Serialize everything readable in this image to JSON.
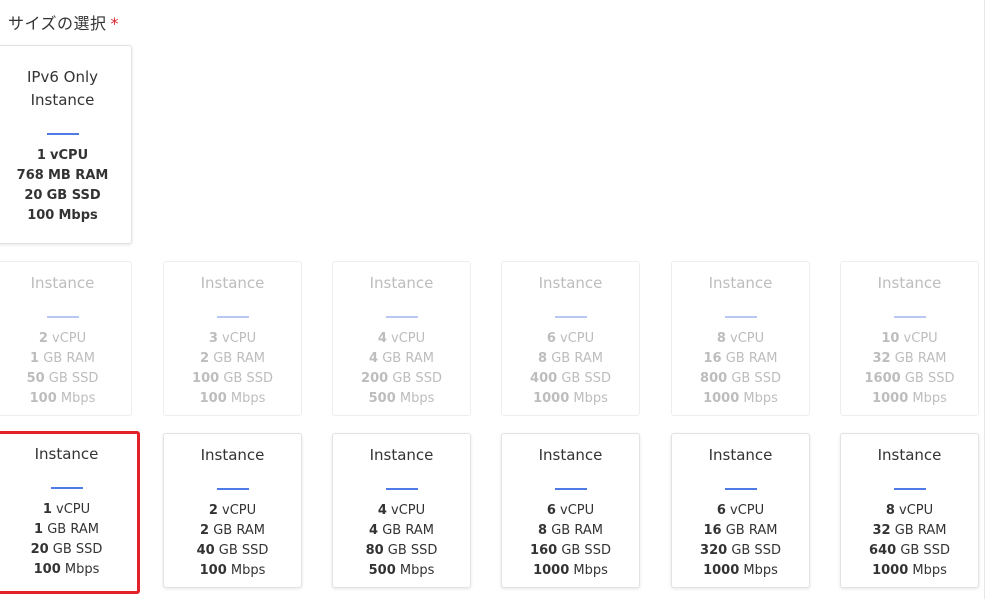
{
  "section": {
    "title": "サイズの選択",
    "required_mark": "*"
  },
  "colors": {
    "accent": "#4f7be8",
    "selected_border": "#e3212b",
    "required": "#e0202a",
    "disabled_text": "#bdbdbd"
  },
  "ipv6_plan": {
    "title_line1": "IPv6 Only",
    "title_line2": "Instance",
    "vcpu_num": "1",
    "vcpu_unit": "vCPU",
    "ram_num": "768",
    "ram_unit": "MB RAM",
    "ssd_num": "20",
    "ssd_unit": "GB SSD",
    "net_num": "100",
    "net_unit": "Mbps"
  },
  "disabled_plans": [
    {
      "title": "Instance",
      "vcpu_num": "2",
      "vcpu_unit": "vCPU",
      "ram_num": "1",
      "ram_unit": "GB RAM",
      "ssd_num": "50",
      "ssd_unit": "GB SSD",
      "net_num": "100",
      "net_unit": "Mbps"
    },
    {
      "title": "Instance",
      "vcpu_num": "3",
      "vcpu_unit": "vCPU",
      "ram_num": "2",
      "ram_unit": "GB RAM",
      "ssd_num": "100",
      "ssd_unit": "GB SSD",
      "net_num": "100",
      "net_unit": "Mbps"
    },
    {
      "title": "Instance",
      "vcpu_num": "4",
      "vcpu_unit": "vCPU",
      "ram_num": "4",
      "ram_unit": "GB RAM",
      "ssd_num": "200",
      "ssd_unit": "GB SSD",
      "net_num": "500",
      "net_unit": "Mbps"
    },
    {
      "title": "Instance",
      "vcpu_num": "6",
      "vcpu_unit": "vCPU",
      "ram_num": "8",
      "ram_unit": "GB RAM",
      "ssd_num": "400",
      "ssd_unit": "GB SSD",
      "net_num": "1000",
      "net_unit": "Mbps"
    },
    {
      "title": "Instance",
      "vcpu_num": "8",
      "vcpu_unit": "vCPU",
      "ram_num": "16",
      "ram_unit": "GB RAM",
      "ssd_num": "800",
      "ssd_unit": "GB SSD",
      "net_num": "1000",
      "net_unit": "Mbps"
    },
    {
      "title": "Instance",
      "vcpu_num": "10",
      "vcpu_unit": "vCPU",
      "ram_num": "32",
      "ram_unit": "GB RAM",
      "ssd_num": "1600",
      "ssd_unit": "GB SSD",
      "net_num": "1000",
      "net_unit": "Mbps"
    }
  ],
  "plans": [
    {
      "title": "Instance",
      "vcpu_num": "1",
      "vcpu_unit": "vCPU",
      "ram_num": "1",
      "ram_unit": "GB RAM",
      "ssd_num": "20",
      "ssd_unit": "GB SSD",
      "net_num": "100",
      "net_unit": "Mbps"
    },
    {
      "title": "Instance",
      "vcpu_num": "2",
      "vcpu_unit": "vCPU",
      "ram_num": "2",
      "ram_unit": "GB RAM",
      "ssd_num": "40",
      "ssd_unit": "GB SSD",
      "net_num": "100",
      "net_unit": "Mbps"
    },
    {
      "title": "Instance",
      "vcpu_num": "4",
      "vcpu_unit": "vCPU",
      "ram_num": "4",
      "ram_unit": "GB RAM",
      "ssd_num": "80",
      "ssd_unit": "GB SSD",
      "net_num": "500",
      "net_unit": "Mbps"
    },
    {
      "title": "Instance",
      "vcpu_num": "6",
      "vcpu_unit": "vCPU",
      "ram_num": "8",
      "ram_unit": "GB RAM",
      "ssd_num": "160",
      "ssd_unit": "GB SSD",
      "net_num": "1000",
      "net_unit": "Mbps"
    },
    {
      "title": "Instance",
      "vcpu_num": "6",
      "vcpu_unit": "vCPU",
      "ram_num": "16",
      "ram_unit": "GB RAM",
      "ssd_num": "320",
      "ssd_unit": "GB SSD",
      "net_num": "1000",
      "net_unit": "Mbps"
    },
    {
      "title": "Instance",
      "vcpu_num": "8",
      "vcpu_unit": "vCPU",
      "ram_num": "32",
      "ram_unit": "GB RAM",
      "ssd_num": "640",
      "ssd_unit": "GB SSD",
      "net_num": "1000",
      "net_unit": "Mbps"
    }
  ]
}
